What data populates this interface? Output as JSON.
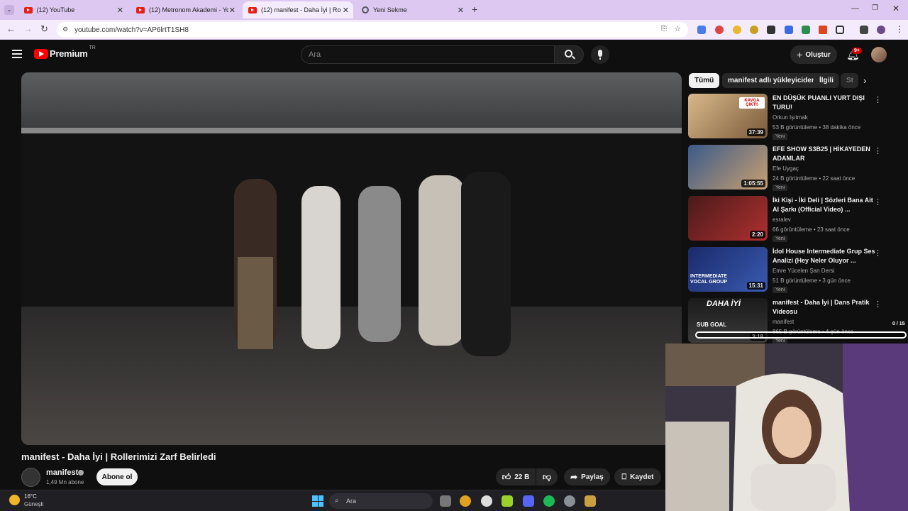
{
  "browser": {
    "tabs": [
      {
        "title": "(12) YouTube",
        "active": false
      },
      {
        "title": "(12) Metronom Akademi - YouT",
        "active": false
      },
      {
        "title": "(12) manifest - Daha İyi | Rollerir",
        "active": true
      },
      {
        "title": "Yeni Sekme",
        "active": false
      }
    ],
    "url": "youtube.com/watch?v=AP6lrtT1SH8"
  },
  "youtube": {
    "logo": "Premium",
    "region": "TR",
    "search_placeholder": "Ara",
    "create_label": "Oluştur",
    "notifications": "9+"
  },
  "video": {
    "title": "manifest - Daha İyi | Rollerimizi Zarf Belirledi",
    "channel": "manifest",
    "subscribers": "1,49 Mn abone",
    "subscribe_label": "Abone ol",
    "likes": "22 B",
    "share_label": "Paylaş",
    "save_label": "Kaydet"
  },
  "chips": [
    "Tümü",
    "manifest adlı yükleyiciden",
    "İlgili",
    "St"
  ],
  "recommendations": [
    {
      "title": "EN DÜŞÜK PUANLI YURT DIŞI TURU!",
      "channel": "Orkun Işıtmak",
      "meta": "53 B görüntüleme • 38 dakika önce",
      "badge": "Yeni",
      "duration": "37:39",
      "thumb_text": "KAVGA ÇIKTI!"
    },
    {
      "title": "EFE SHOW S3B25 | HİKAYEDEN ADAMLAR",
      "channel": "Efe Uygaç",
      "meta": "24 B görüntüleme • 22 saat önce",
      "badge": "Yeni",
      "duration": "1:05:55",
      "thumb_text": ""
    },
    {
      "title": "İki Kişi - İki Deli | Sözleri Bana Ait AI Şarkı (Official Video) ...",
      "channel": "esralev",
      "meta": "66 görüntüleme • 23 saat önce",
      "badge": "Yeni",
      "duration": "2:20",
      "thumb_text": ""
    },
    {
      "title": "İdol House Intermediate Grup Ses Analizi (Hey Neler Oluyor ...",
      "channel": "Emre Yücelen Şan Dersi",
      "meta": "51 B görüntüleme • 3 gün önce",
      "badge": "Yeni",
      "duration": "15:31",
      "thumb_text": "INTERMEDIATE VOCAL GROUP"
    },
    {
      "title": "manifest - Daha İyi | Dans Pratik Videosu",
      "channel": "manifest",
      "meta": "865 B görüntüleme • 4 gün önce",
      "badge": "Yeni",
      "duration": "3:18",
      "thumb_text": "DAHA İYİ"
    }
  ],
  "overlay": {
    "sub_goal_label": "SUB GOAL",
    "sub_goal_value": "0 / 15",
    "sub_goal_progress": 0
  },
  "taskbar": {
    "temperature": "16°C",
    "weather": "Güneşli",
    "search_placeholder": "Ara"
  },
  "colors": {
    "brand_red": "#ff0000",
    "background": "#0f0f0f",
    "tabbar": "#dcc8f0"
  }
}
